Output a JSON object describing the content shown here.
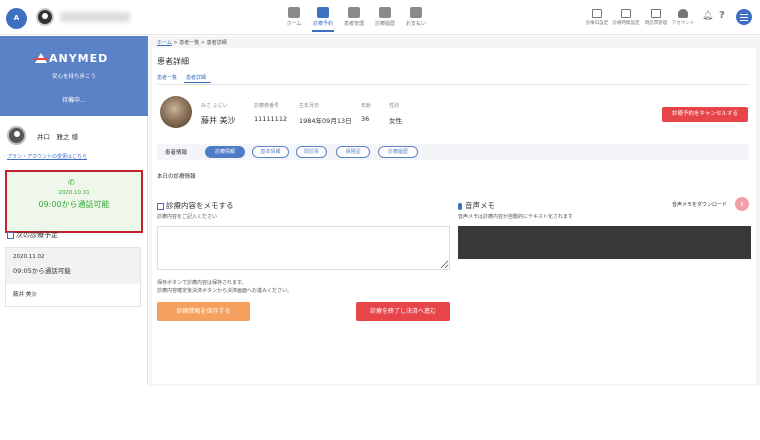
{
  "topbar": {
    "logo_text": "ANYMED",
    "nav": [
      {
        "label": "ホーム",
        "icon": "home-icon"
      },
      {
        "label": "診療予約",
        "icon": "calendar-icon",
        "active": true
      },
      {
        "label": "患者管理",
        "icon": "patients-icon"
      },
      {
        "label": "診療履歴",
        "icon": "history-icon"
      },
      {
        "label": "お支払い",
        "icon": "payment-icon"
      }
    ],
    "right_nav": [
      {
        "label": "診療日設定",
        "icon": "schedule-icon"
      },
      {
        "label": "診療時間設定",
        "icon": "clock-settings-icon"
      },
      {
        "label": "問診票管理",
        "icon": "folder-icon"
      },
      {
        "label": "アカウント",
        "icon": "account-icon"
      }
    ]
  },
  "sidebar": {
    "brand": "ANYMED",
    "tagline": "安心を持ち歩こう",
    "status": "待機中…",
    "doctor_name": "井口　雅之 様",
    "plan_link": "プラン・アカウントの変更はこちら",
    "current_slot": {
      "date": "2020.10.31",
      "text": "09:00から通話可能"
    },
    "next_title": "次の診療予定",
    "next_appointment": {
      "date": "2020.11.02",
      "time": "09:05から通話可能",
      "patient": "藤井 美沙"
    }
  },
  "main": {
    "breadcrumb": {
      "home": "ホーム",
      "list": "患者一覧",
      "current": "患者詳細",
      "sep": " > "
    },
    "title": "患者詳細",
    "tabs": [
      "患者一覧",
      "患者詳細"
    ],
    "patient": {
      "kana": "みさ ふじい",
      "name": "藤井 美沙",
      "id_label": "診療券番号",
      "id": "11111112",
      "birth_label": "生年月日",
      "birth": "1984年09月13日",
      "age_label": "年齢",
      "age": "36",
      "sex_label": "性別",
      "sex": "女性"
    },
    "cancel_button": "診療予約をキャンセルする",
    "info_label": "患者情報",
    "pills": [
      "診療情報",
      "基本情報",
      "問診票",
      "保険証",
      "診療履歴"
    ],
    "today_label": "本日の診療情報",
    "memo": {
      "title": "診療内容をメモする",
      "subtitle": "診療内容をご記入ください",
      "note1": "保存ボタンで診療内容は保存されます。",
      "note2": "診療内容確定後決済ボタンから決済画面へお進みください。"
    },
    "voice": {
      "title": "音声メモ",
      "subtitle": "音声メモは診療内容が自動的にテキスト化されます",
      "download": "音声メモをダウンロード"
    },
    "save_button": "診療情報を保存する",
    "finish_button": "診療を終了し決済へ進む"
  }
}
